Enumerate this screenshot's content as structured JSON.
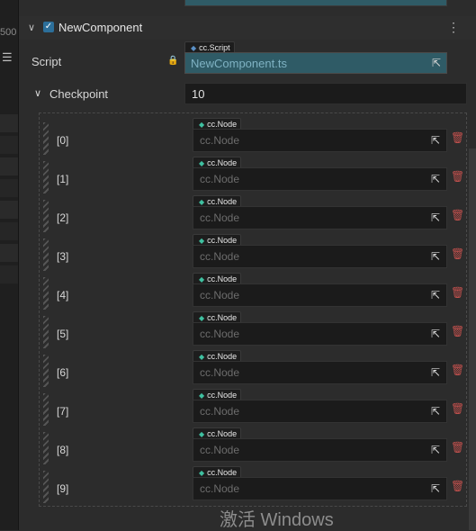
{
  "left_ruler_label": "500",
  "menu_icon": "hamburger-icon",
  "component": {
    "expand_icon": "chevron-down-icon",
    "enabled_icon": "checkmark-icon",
    "title": "NewComponent",
    "menu_icon": "kebab-icon"
  },
  "script": {
    "label": "Script",
    "lock_icon": "lock-icon",
    "type_tag": "cc.Script",
    "value": "NewComponent.ts",
    "pick_icon": "target-pick-icon"
  },
  "checkpoint": {
    "label": "Checkpoint",
    "count": "10",
    "items": [
      {
        "index": "[0]",
        "type_tag": "cc.Node",
        "placeholder": "cc.Node"
      },
      {
        "index": "[1]",
        "type_tag": "cc.Node",
        "placeholder": "cc.Node"
      },
      {
        "index": "[2]",
        "type_tag": "cc.Node",
        "placeholder": "cc.Node"
      },
      {
        "index": "[3]",
        "type_tag": "cc.Node",
        "placeholder": "cc.Node"
      },
      {
        "index": "[4]",
        "type_tag": "cc.Node",
        "placeholder": "cc.Node"
      },
      {
        "index": "[5]",
        "type_tag": "cc.Node",
        "placeholder": "cc.Node"
      },
      {
        "index": "[6]",
        "type_tag": "cc.Node",
        "placeholder": "cc.Node"
      },
      {
        "index": "[7]",
        "type_tag": "cc.Node",
        "placeholder": "cc.Node"
      },
      {
        "index": "[8]",
        "type_tag": "cc.Node",
        "placeholder": "cc.Node"
      },
      {
        "index": "[9]",
        "type_tag": "cc.Node",
        "placeholder": "cc.Node"
      }
    ]
  },
  "watermark": "激活 Windows",
  "colors": {
    "background": "#2c2c2c",
    "script_field": "#2f5b66",
    "checkbox": "#2c6f9a",
    "node_tag_diamond": "#3fc0a0",
    "delete": "#c0504d"
  }
}
